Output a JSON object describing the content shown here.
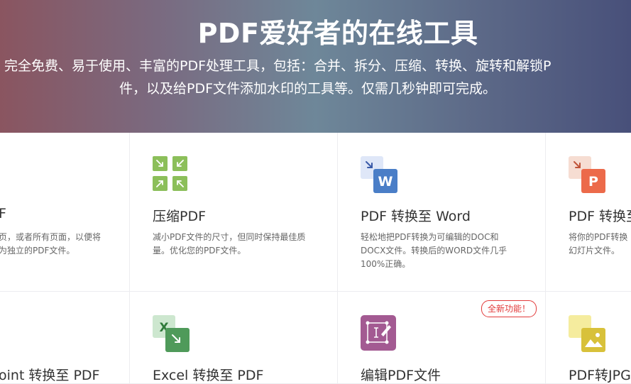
{
  "hero": {
    "title": "PDF爱好者的在线工具",
    "subtitle_line1": "完全免费、易于使用、丰富的PDF处理工具，包括：合并、拆分、压缩、转换、旋转和解锁P",
    "subtitle_line2": "件，以及给PDF文件添加水印的工具等。仅需几秒钟即可完成。"
  },
  "tools": [
    {
      "title": "F",
      "desc_line1": "页，或者所有页面，以便将",
      "desc_line2": "为独立的PDF文件。",
      "desc_line3": ""
    },
    {
      "title": "压缩PDF",
      "desc_line1": "减小PDF文件的尺寸，但同时保持最佳质",
      "desc_line2": "量。优化您的PDF文件。",
      "desc_line3": ""
    },
    {
      "title": "PDF 转换至 Word",
      "desc_line1": "轻松地把PDF转换为可编辑的DOC和",
      "desc_line2": "DOCX文件。转换后的WORD文件几乎",
      "desc_line3": "100%正确。"
    },
    {
      "title": "PDF 转换至",
      "desc_line1": "将你的PDF转换",
      "desc_line2": "幻灯片文件。",
      "desc_line3": ""
    },
    {
      "title": "oint 转换至 PDF"
    },
    {
      "title": "Excel 转换至 PDF"
    },
    {
      "title": "编辑PDF文件",
      "badge": "全新功能！"
    },
    {
      "title": "PDF转JPG"
    }
  ],
  "icons": {
    "word_letter": "W",
    "ppt_letter": "P",
    "excel_letter": "X",
    "colors": {
      "compress": "#8cbf5a",
      "word": "#4a7ec7",
      "ppt": "#ec6a4a",
      "excel": "#4f9a5a",
      "edit": "#a35a92",
      "jpg": "#d8c13a"
    }
  }
}
